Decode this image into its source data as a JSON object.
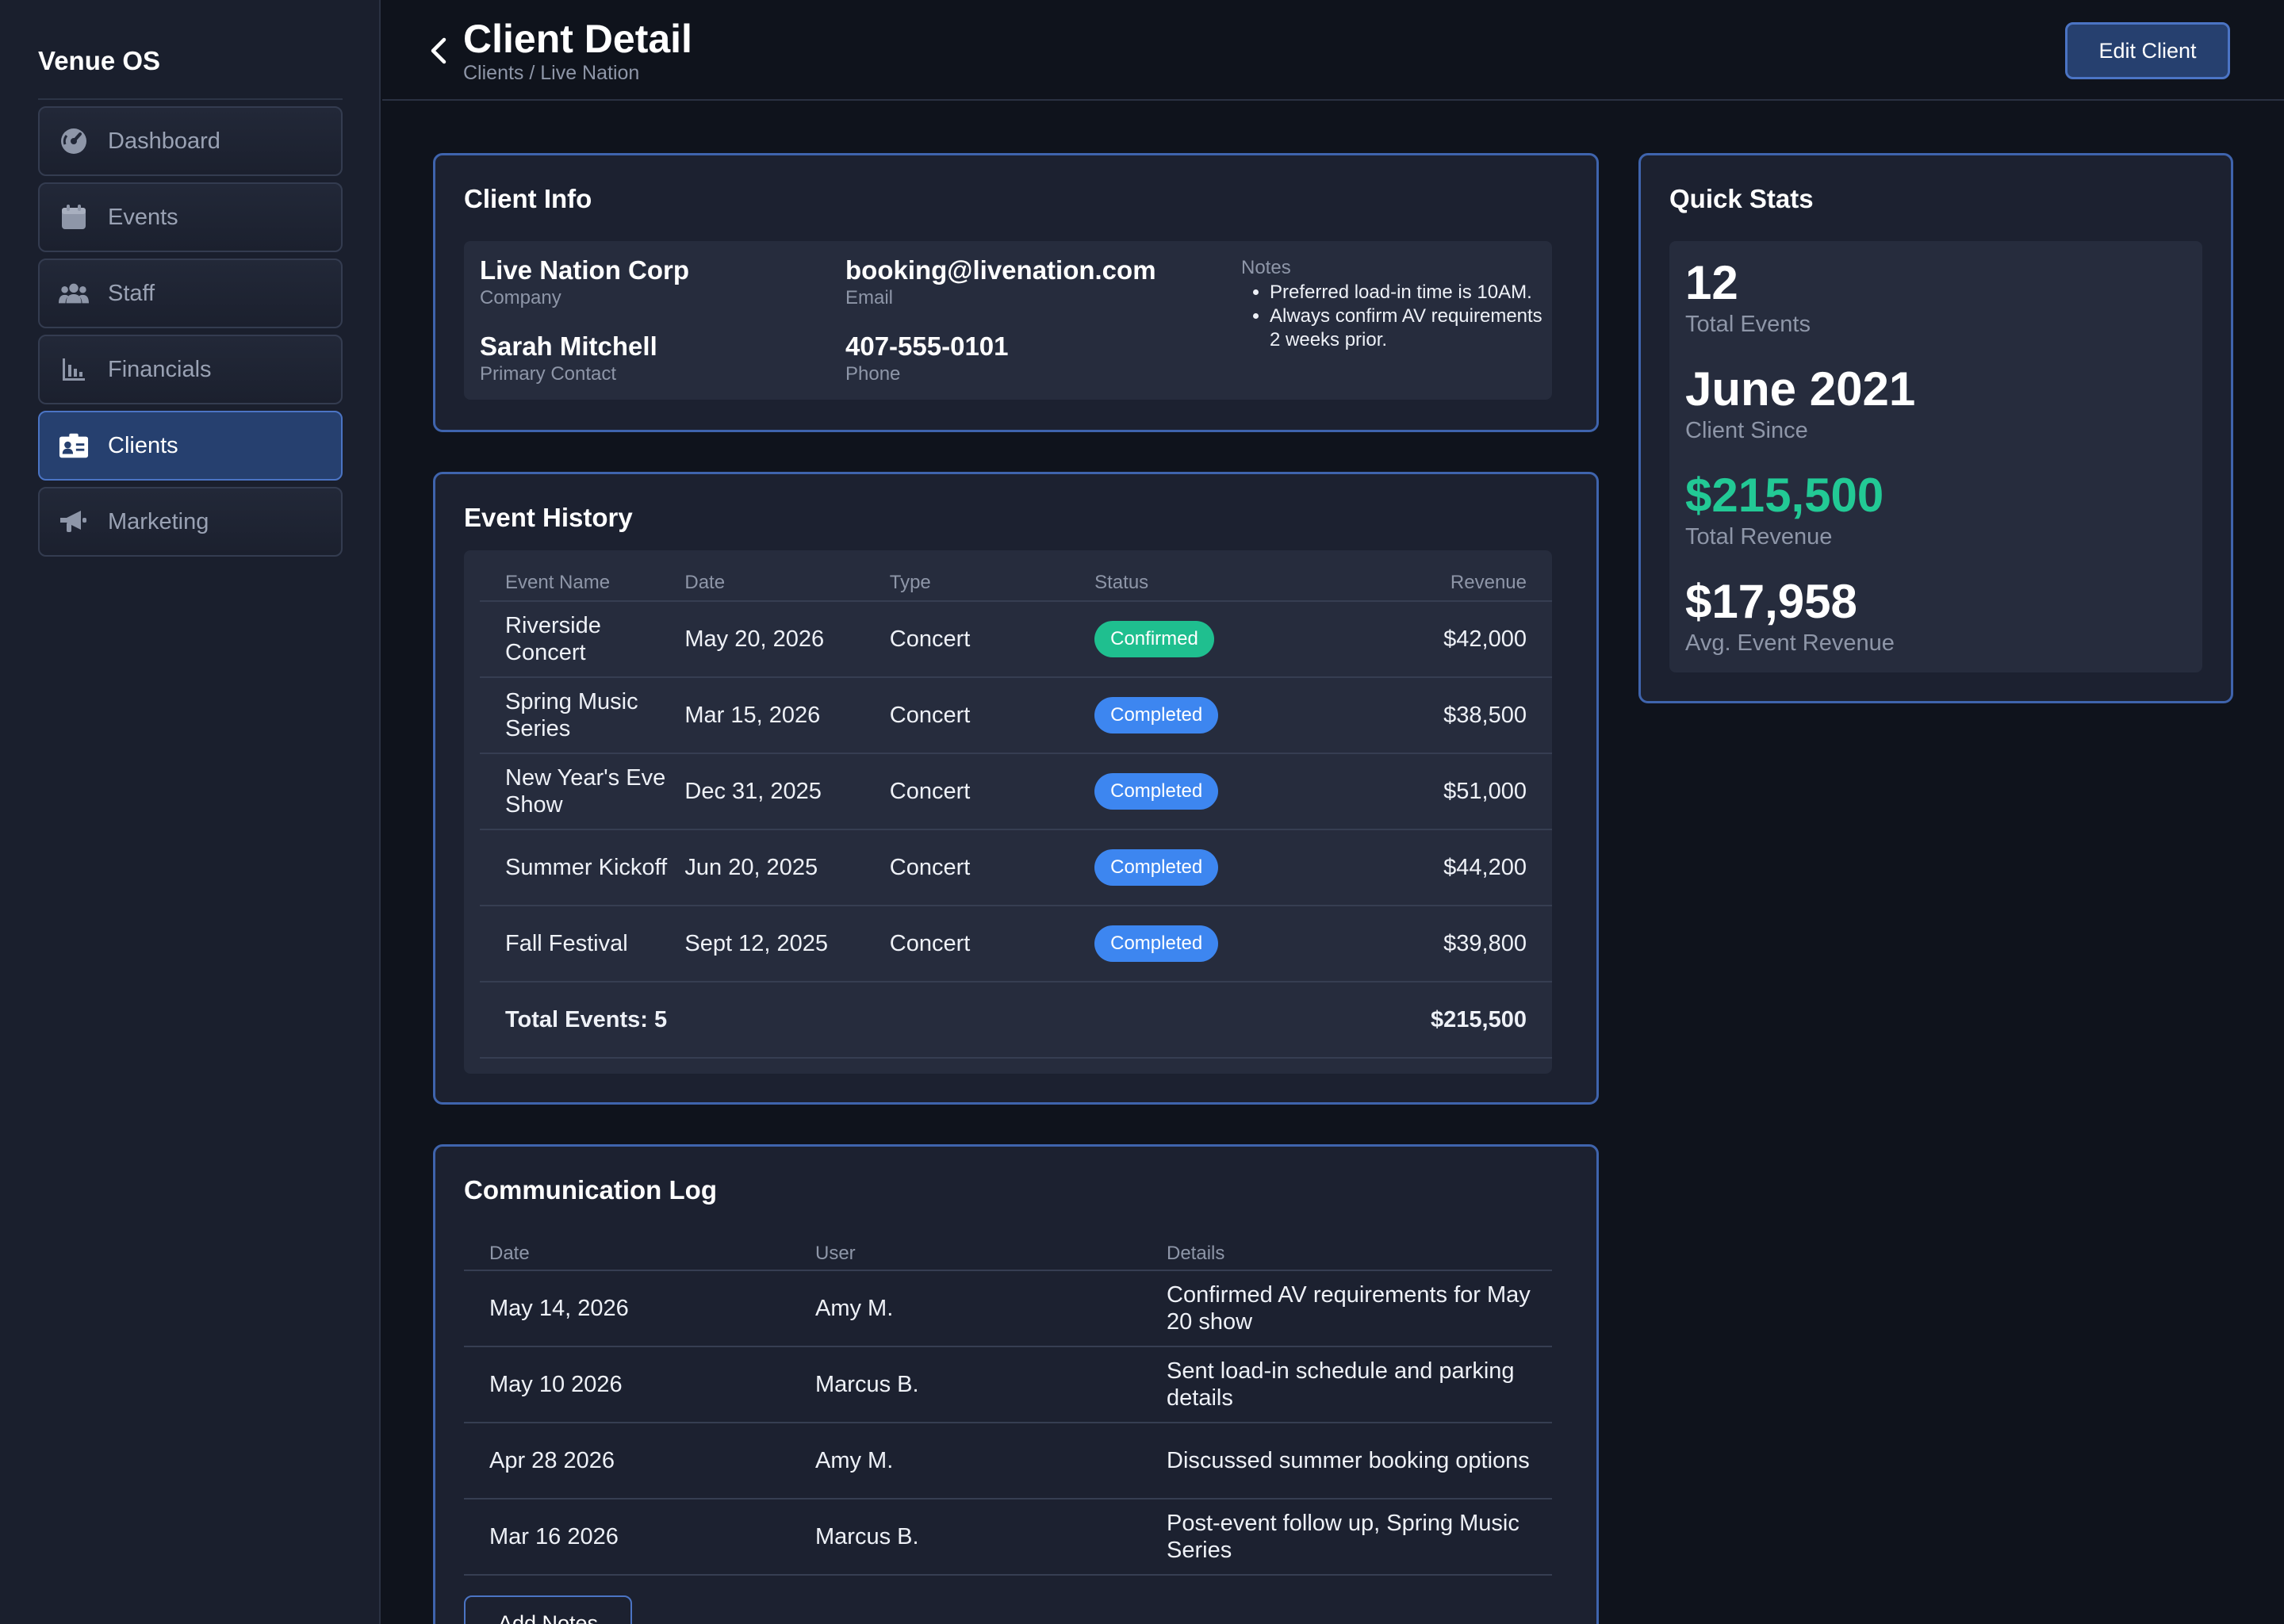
{
  "app": {
    "name": "Venue OS"
  },
  "sidebar": {
    "items": [
      {
        "label": "Dashboard",
        "icon": "gauge-icon"
      },
      {
        "label": "Events",
        "icon": "calendar-icon"
      },
      {
        "label": "Staff",
        "icon": "users-icon"
      },
      {
        "label": "Financials",
        "icon": "bar-chart-icon"
      },
      {
        "label": "Clients",
        "icon": "id-card-icon",
        "active": true
      },
      {
        "label": "Marketing",
        "icon": "megaphone-icon"
      }
    ]
  },
  "header": {
    "title": "Client Detail",
    "breadcrumb": "Clients / Live Nation",
    "edit_label": "Edit Client"
  },
  "client_info": {
    "title": "Client Info",
    "company": {
      "value": "Live Nation Corp",
      "label": "Company"
    },
    "email": {
      "value": "booking@livenation.com",
      "label": "Email"
    },
    "contact": {
      "value": "Sarah Mitchell",
      "label": "Primary Contact"
    },
    "phone": {
      "value": "407-555-0101",
      "label": "Phone"
    },
    "notes": {
      "label": "Notes",
      "items": [
        "Preferred load-in time is 10AM.",
        "Always confirm AV requirements 2 weeks prior."
      ]
    }
  },
  "event_history": {
    "title": "Event History",
    "columns": [
      "Event Name",
      "Date",
      "Type",
      "Status",
      "Revenue"
    ],
    "rows": [
      {
        "name": "Riverside Concert",
        "date": "May 20, 2026",
        "type": "Concert",
        "status": "Confirmed",
        "revenue": "$42,000"
      },
      {
        "name": "Spring Music Series",
        "date": "Mar 15, 2026",
        "type": "Concert",
        "status": "Completed",
        "revenue": "$38,500"
      },
      {
        "name": "New Year's Eve Show",
        "date": "Dec 31, 2025",
        "type": "Concert",
        "status": "Completed",
        "revenue": "$51,000"
      },
      {
        "name": "Summer Kickoff",
        "date": "Jun 20, 2025",
        "type": "Concert",
        "status": "Completed",
        "revenue": "$44,200"
      },
      {
        "name": "Fall Festival",
        "date": "Sept 12, 2025",
        "type": "Concert",
        "status": "Completed",
        "revenue": "$39,800"
      }
    ],
    "total_label": "Total Events: 5",
    "total_revenue": "$215,500"
  },
  "communication_log": {
    "title": "Communication Log",
    "columns": [
      "Date",
      "User",
      "Details"
    ],
    "rows": [
      {
        "date": "May 14, 2026",
        "user": "Amy M.",
        "details": "Confirmed AV requirements for May 20 show"
      },
      {
        "date": "May 10 2026",
        "user": "Marcus B.",
        "details": "Sent load-in schedule and parking details"
      },
      {
        "date": "Apr 28 2026",
        "user": "Amy M.",
        "details": "Discussed summer booking options"
      },
      {
        "date": "Mar 16 2026",
        "user": "Marcus B.",
        "details": "Post-event follow up, Spring Music Series"
      }
    ],
    "add_label": "Add Notes"
  },
  "quick_stats": {
    "title": "Quick Stats",
    "items": [
      {
        "value": "12",
        "label": "Total Events"
      },
      {
        "value": "June 2021",
        "label": "Client Since"
      },
      {
        "value": "$215,500",
        "label": "Total Revenue"
      },
      {
        "value": "$17,958",
        "label": "Avg. Event Revenue"
      }
    ]
  },
  "colors": {
    "background": "#0f131c",
    "sidebar": "#1a1f2d",
    "card": "#1c2130",
    "accent": "#4b74c4",
    "confirmed": "#1fbf8f",
    "completed": "#3d86f0",
    "revenue_green": "#22c995"
  }
}
